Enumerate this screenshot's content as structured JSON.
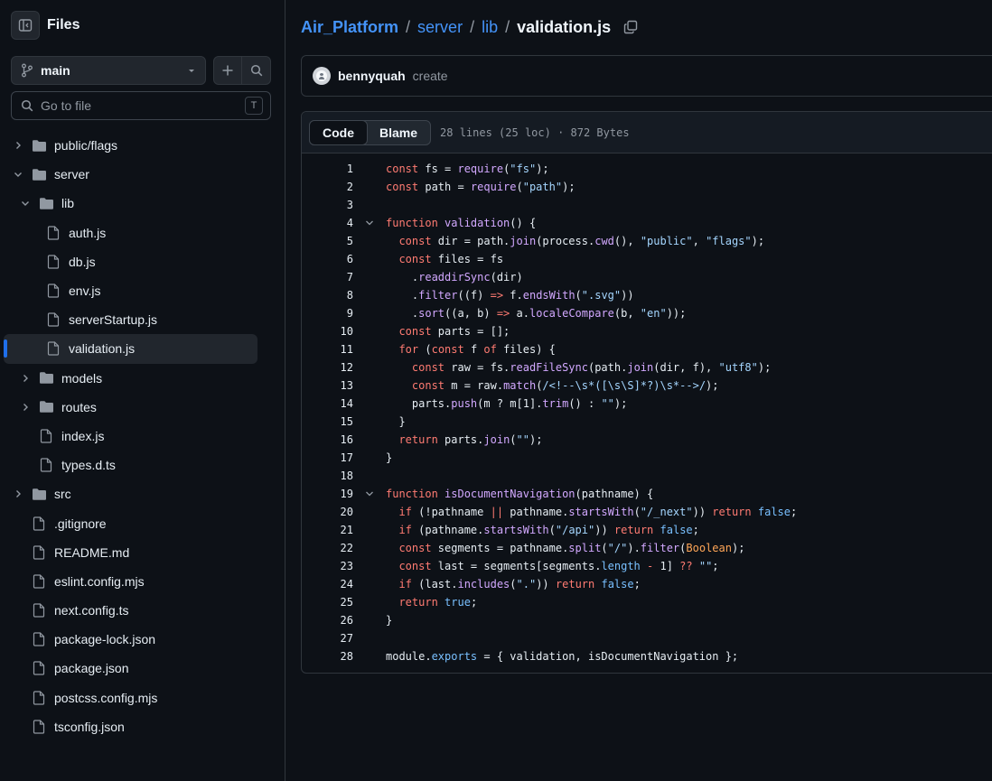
{
  "sidebar": {
    "title": "Files",
    "branch": "main",
    "goto_placeholder": "Go to file",
    "goto_shortcut": "T",
    "tree": [
      {
        "name": "public/flags",
        "type": "folder",
        "depth": 0,
        "expanded": false
      },
      {
        "name": "server",
        "type": "folder",
        "depth": 0,
        "expanded": true
      },
      {
        "name": "lib",
        "type": "folder",
        "depth": 1,
        "expanded": true
      },
      {
        "name": "auth.js",
        "type": "file",
        "depth": 2
      },
      {
        "name": "db.js",
        "type": "file",
        "depth": 2
      },
      {
        "name": "env.js",
        "type": "file",
        "depth": 2
      },
      {
        "name": "serverStartup.js",
        "type": "file",
        "depth": 2
      },
      {
        "name": "validation.js",
        "type": "file",
        "depth": 2,
        "selected": true
      },
      {
        "name": "models",
        "type": "folder",
        "depth": 1,
        "expanded": false
      },
      {
        "name": "routes",
        "type": "folder",
        "depth": 1,
        "expanded": false
      },
      {
        "name": "index.js",
        "type": "file",
        "depth": 1
      },
      {
        "name": "types.d.ts",
        "type": "file",
        "depth": 1
      },
      {
        "name": "src",
        "type": "folder",
        "depth": 0,
        "expanded": false
      },
      {
        "name": ".gitignore",
        "type": "file",
        "depth": 0
      },
      {
        "name": "README.md",
        "type": "file",
        "depth": 0
      },
      {
        "name": "eslint.config.mjs",
        "type": "file",
        "depth": 0
      },
      {
        "name": "next.config.ts",
        "type": "file",
        "depth": 0
      },
      {
        "name": "package-lock.json",
        "type": "file",
        "depth": 0
      },
      {
        "name": "package.json",
        "type": "file",
        "depth": 0
      },
      {
        "name": "postcss.config.mjs",
        "type": "file",
        "depth": 0
      },
      {
        "name": "tsconfig.json",
        "type": "file",
        "depth": 0
      }
    ]
  },
  "breadcrumb": {
    "repo": "Air_Platform",
    "sep": "/",
    "dir1": "server",
    "dir2": "lib",
    "file": "validation.js"
  },
  "commit": {
    "author": "bennyquah",
    "message": "create"
  },
  "code_view": {
    "tab_code": "Code",
    "tab_blame": "Blame",
    "file_info": "28 lines (25 loc) · 872 Bytes",
    "lines": [
      {
        "n": "1",
        "fold": false,
        "tokens": [
          [
            "k",
            "const"
          ],
          [
            "t",
            " fs = "
          ],
          [
            "f",
            "require"
          ],
          [
            "t",
            "("
          ],
          [
            "s",
            "\"fs\""
          ],
          [
            "t",
            ");"
          ]
        ]
      },
      {
        "n": "2",
        "fold": false,
        "tokens": [
          [
            "k",
            "const"
          ],
          [
            "t",
            " path = "
          ],
          [
            "f",
            "require"
          ],
          [
            "t",
            "("
          ],
          [
            "s",
            "\"path\""
          ],
          [
            "t",
            ");"
          ]
        ]
      },
      {
        "n": "3",
        "fold": false,
        "tokens": []
      },
      {
        "n": "4",
        "fold": true,
        "tokens": [
          [
            "k",
            "function"
          ],
          [
            "t",
            " "
          ],
          [
            "f",
            "validation"
          ],
          [
            "t",
            "() {"
          ]
        ]
      },
      {
        "n": "5",
        "fold": false,
        "tokens": [
          [
            "t",
            "  "
          ],
          [
            "k",
            "const"
          ],
          [
            "t",
            " dir = path."
          ],
          [
            "f",
            "join"
          ],
          [
            "t",
            "(process."
          ],
          [
            "f",
            "cwd"
          ],
          [
            "t",
            "(), "
          ],
          [
            "s",
            "\"public\""
          ],
          [
            "t",
            ", "
          ],
          [
            "s",
            "\"flags\""
          ],
          [
            "t",
            ");"
          ]
        ]
      },
      {
        "n": "6",
        "fold": false,
        "tokens": [
          [
            "t",
            "  "
          ],
          [
            "k",
            "const"
          ],
          [
            "t",
            " files = fs"
          ]
        ]
      },
      {
        "n": "7",
        "fold": false,
        "tokens": [
          [
            "t",
            "    ."
          ],
          [
            "f",
            "readdirSync"
          ],
          [
            "t",
            "(dir)"
          ]
        ]
      },
      {
        "n": "8",
        "fold": false,
        "tokens": [
          [
            "t",
            "    ."
          ],
          [
            "f",
            "filter"
          ],
          [
            "t",
            "((f) "
          ],
          [
            "k",
            "=>"
          ],
          [
            "t",
            " f."
          ],
          [
            "f",
            "endsWith"
          ],
          [
            "t",
            "("
          ],
          [
            "s",
            "\".svg\""
          ],
          [
            "t",
            "))"
          ]
        ]
      },
      {
        "n": "9",
        "fold": false,
        "tokens": [
          [
            "t",
            "    ."
          ],
          [
            "f",
            "sort"
          ],
          [
            "t",
            "((a, b) "
          ],
          [
            "k",
            "=>"
          ],
          [
            "t",
            " a."
          ],
          [
            "f",
            "localeCompare"
          ],
          [
            "t",
            "(b, "
          ],
          [
            "s",
            "\"en\""
          ],
          [
            "t",
            "));"
          ]
        ]
      },
      {
        "n": "10",
        "fold": false,
        "tokens": [
          [
            "t",
            "  "
          ],
          [
            "k",
            "const"
          ],
          [
            "t",
            " parts = [];"
          ]
        ]
      },
      {
        "n": "11",
        "fold": false,
        "tokens": [
          [
            "t",
            "  "
          ],
          [
            "k",
            "for"
          ],
          [
            "t",
            " ("
          ],
          [
            "k",
            "const"
          ],
          [
            "t",
            " f "
          ],
          [
            "k",
            "of"
          ],
          [
            "t",
            " files) {"
          ]
        ]
      },
      {
        "n": "12",
        "fold": false,
        "tokens": [
          [
            "t",
            "    "
          ],
          [
            "k",
            "const"
          ],
          [
            "t",
            " raw = fs."
          ],
          [
            "f",
            "readFileSync"
          ],
          [
            "t",
            "(path."
          ],
          [
            "f",
            "join"
          ],
          [
            "t",
            "(dir, f), "
          ],
          [
            "s",
            "\"utf8\""
          ],
          [
            "t",
            ");"
          ]
        ]
      },
      {
        "n": "13",
        "fold": false,
        "tokens": [
          [
            "t",
            "    "
          ],
          [
            "k",
            "const"
          ],
          [
            "t",
            " m = raw."
          ],
          [
            "f",
            "match"
          ],
          [
            "t",
            "("
          ],
          [
            "s",
            "/<!--\\s*([\\s\\S]*?)\\s*-->/"
          ],
          [
            "t",
            ");"
          ]
        ]
      },
      {
        "n": "14",
        "fold": false,
        "tokens": [
          [
            "t",
            "    parts."
          ],
          [
            "f",
            "push"
          ],
          [
            "t",
            "(m ? m[1]."
          ],
          [
            "f",
            "trim"
          ],
          [
            "t",
            "() : "
          ],
          [
            "s",
            "\"\""
          ],
          [
            "t",
            ");"
          ]
        ]
      },
      {
        "n": "15",
        "fold": false,
        "tokens": [
          [
            "t",
            "  }"
          ]
        ]
      },
      {
        "n": "16",
        "fold": false,
        "tokens": [
          [
            "t",
            "  "
          ],
          [
            "k",
            "return"
          ],
          [
            "t",
            " parts."
          ],
          [
            "f",
            "join"
          ],
          [
            "t",
            "("
          ],
          [
            "s",
            "\"\""
          ],
          [
            "t",
            ");"
          ]
        ]
      },
      {
        "n": "17",
        "fold": false,
        "tokens": [
          [
            "t",
            "}"
          ]
        ]
      },
      {
        "n": "18",
        "fold": false,
        "tokens": []
      },
      {
        "n": "19",
        "fold": true,
        "tokens": [
          [
            "k",
            "function"
          ],
          [
            "t",
            " "
          ],
          [
            "f",
            "isDocumentNavigation"
          ],
          [
            "t",
            "(pathname) {"
          ]
        ]
      },
      {
        "n": "20",
        "fold": false,
        "tokens": [
          [
            "t",
            "  "
          ],
          [
            "k",
            "if"
          ],
          [
            "t",
            " (!pathname "
          ],
          [
            "k",
            "||"
          ],
          [
            "t",
            " pathname."
          ],
          [
            "f",
            "startsWith"
          ],
          [
            "t",
            "("
          ],
          [
            "s",
            "\"/_next\""
          ],
          [
            "t",
            ")) "
          ],
          [
            "k",
            "return"
          ],
          [
            "t",
            " "
          ],
          [
            "c",
            "false"
          ],
          [
            "t",
            ";"
          ]
        ]
      },
      {
        "n": "21",
        "fold": false,
        "tokens": [
          [
            "t",
            "  "
          ],
          [
            "k",
            "if"
          ],
          [
            "t",
            " (pathname."
          ],
          [
            "f",
            "startsWith"
          ],
          [
            "t",
            "("
          ],
          [
            "s",
            "\"/api\""
          ],
          [
            "t",
            ")) "
          ],
          [
            "k",
            "return"
          ],
          [
            "t",
            " "
          ],
          [
            "c",
            "false"
          ],
          [
            "t",
            ";"
          ]
        ]
      },
      {
        "n": "22",
        "fold": false,
        "tokens": [
          [
            "t",
            "  "
          ],
          [
            "k",
            "const"
          ],
          [
            "t",
            " segments = pathname."
          ],
          [
            "f",
            "split"
          ],
          [
            "t",
            "("
          ],
          [
            "s",
            "\"/\""
          ],
          [
            "t",
            ")."
          ],
          [
            "f",
            "filter"
          ],
          [
            "t",
            "("
          ],
          [
            "o",
            "Boolean"
          ],
          [
            "t",
            ");"
          ]
        ]
      },
      {
        "n": "23",
        "fold": false,
        "tokens": [
          [
            "t",
            "  "
          ],
          [
            "k",
            "const"
          ],
          [
            "t",
            " last = segments[segments."
          ],
          [
            "c",
            "length"
          ],
          [
            "t",
            " "
          ],
          [
            "k",
            "-"
          ],
          [
            "t",
            " 1] "
          ],
          [
            "k",
            "??"
          ],
          [
            "t",
            " "
          ],
          [
            "s",
            "\"\""
          ],
          [
            "t",
            ";"
          ]
        ]
      },
      {
        "n": "24",
        "fold": false,
        "tokens": [
          [
            "t",
            "  "
          ],
          [
            "k",
            "if"
          ],
          [
            "t",
            " (last."
          ],
          [
            "f",
            "includes"
          ],
          [
            "t",
            "("
          ],
          [
            "s",
            "\".\""
          ],
          [
            "t",
            ")) "
          ],
          [
            "k",
            "return"
          ],
          [
            "t",
            " "
          ],
          [
            "c",
            "false"
          ],
          [
            "t",
            ";"
          ]
        ]
      },
      {
        "n": "25",
        "fold": false,
        "tokens": [
          [
            "t",
            "  "
          ],
          [
            "k",
            "return"
          ],
          [
            "t",
            " "
          ],
          [
            "c",
            "true"
          ],
          [
            "t",
            ";"
          ]
        ]
      },
      {
        "n": "26",
        "fold": false,
        "tokens": [
          [
            "t",
            "}"
          ]
        ]
      },
      {
        "n": "27",
        "fold": false,
        "tokens": []
      },
      {
        "n": "28",
        "fold": false,
        "tokens": [
          [
            "t",
            "module."
          ],
          [
            "c",
            "exports"
          ],
          [
            "t",
            " = { validation, isDocumentNavigation };"
          ]
        ]
      }
    ]
  },
  "colors": {
    "accent": "#1f6feb",
    "link": "#4493f8",
    "keyword": "#ff7b72",
    "function": "#d2a8ff",
    "string": "#a5d6ff",
    "constant": "#79c0ff",
    "background": "#0d1117"
  },
  "icons": [
    "sidebar-collapse-icon",
    "git-branch-icon",
    "caret-down-icon",
    "plus-icon",
    "search-icon",
    "chevron-right-icon",
    "chevron-down-icon",
    "folder-icon",
    "file-icon",
    "copy-icon",
    "avatar-icon"
  ]
}
